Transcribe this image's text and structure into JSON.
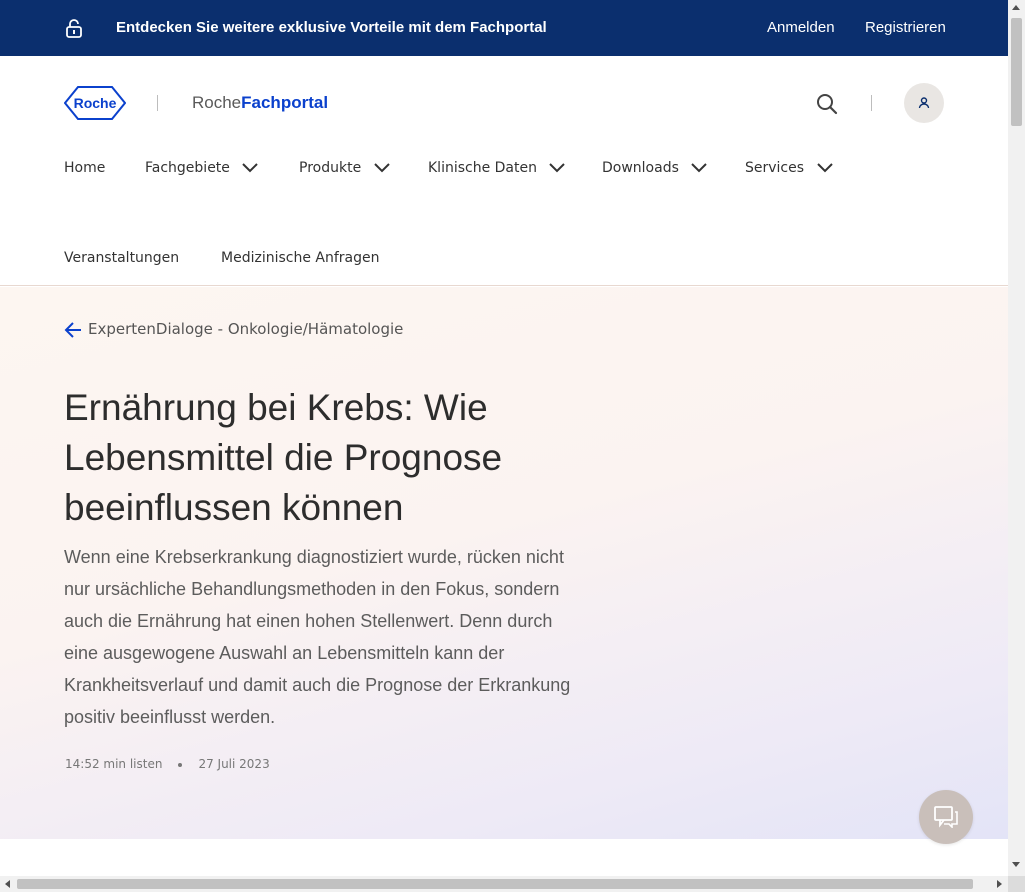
{
  "promo": {
    "text": "Entdecken Sie weitere exklusive Vorteile mit dem Fachportal",
    "login_label": "Anmelden",
    "register_label": "Registrieren",
    "icon": "unlock-icon"
  },
  "header": {
    "logo_text": "Roche",
    "brand_light": "Roche",
    "brand_bold": "Fachportal",
    "search_icon": "search-icon",
    "user_icon": "user-icon"
  },
  "nav": {
    "items": [
      {
        "label": "Home",
        "has_dropdown": false
      },
      {
        "label": "Fachgebiete",
        "has_dropdown": true
      },
      {
        "label": "Produkte",
        "has_dropdown": true
      },
      {
        "label": "Klinische Daten",
        "has_dropdown": true
      },
      {
        "label": "Downloads",
        "has_dropdown": true
      },
      {
        "label": "Services",
        "has_dropdown": true
      },
      {
        "label": "Veranstaltungen",
        "has_dropdown": false
      },
      {
        "label": "Medizinische Anfragen",
        "has_dropdown": false
      }
    ]
  },
  "hero": {
    "back_label": "ExpertenDialoge - Onkologie/Hämatologie",
    "title": "Ernährung bei Krebs: Wie Lebensmittel die Prognose beeinflussen können",
    "lead": "Wenn eine Krebserkrankung diagnostiziert wurde, rücken nicht nur ursächliche Behandlungsmethoden in den Fokus, sondern auch die Ernährung hat einen hohen Stellenwert. Denn durch eine ausgewogene Auswahl an Lebensmitteln kann der Krankheitsverlauf und damit auch die Prognose der Erkrankung positiv beeinflusst werden.",
    "read_time": "14:52 min listen",
    "date": "27 Juli 2023"
  },
  "chat": {
    "icon": "chat-icon"
  },
  "colors": {
    "promo_bg": "#0b2f6e",
    "brand_blue": "#0b41cd",
    "chat_bg": "#c9bfba"
  }
}
